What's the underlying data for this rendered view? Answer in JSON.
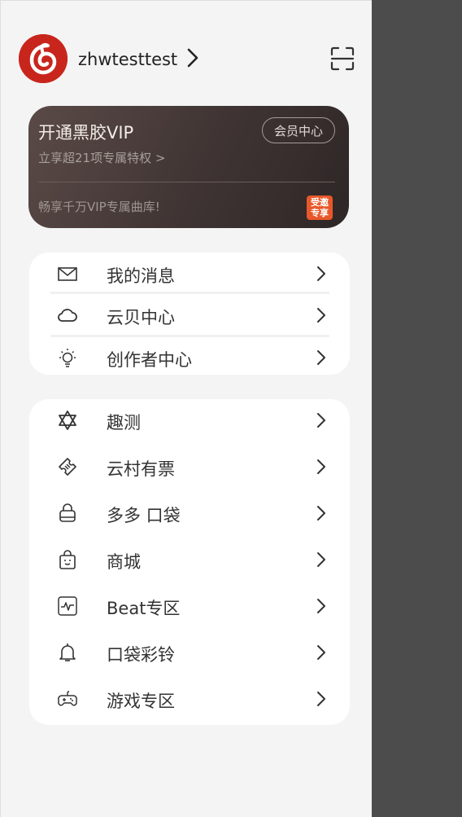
{
  "user": {
    "name": "zhwtesttest"
  },
  "vip": {
    "title": "开通黑胶VIP",
    "subtitle": "立享超21项专属特权 >",
    "center_button": "会员中心",
    "promo": "畅享千万VIP专属曲库!",
    "badge_line1": "受邀",
    "badge_line2": "专享"
  },
  "menu_group1": [
    {
      "label": "我的消息",
      "icon": "mail-icon"
    },
    {
      "label": "云贝中心",
      "icon": "cloud-icon"
    },
    {
      "label": "创作者中心",
      "icon": "lightbulb-icon"
    }
  ],
  "menu_group2": [
    {
      "label": "趣测",
      "icon": "star-of-david-icon"
    },
    {
      "label": "云村有票",
      "icon": "ticket-icon"
    },
    {
      "label": "多多 口袋",
      "icon": "bag-icon"
    },
    {
      "label": "商城",
      "icon": "shopping-bag-icon"
    },
    {
      "label": "Beat专区",
      "icon": "pulse-icon"
    },
    {
      "label": "口袋彩铃",
      "icon": "bell-icon"
    },
    {
      "label": "游戏专区",
      "icon": "gamepad-icon"
    }
  ],
  "colors": {
    "brand": "#c8261c",
    "overlay": "#4c4c4c",
    "badge": "#e8582a"
  }
}
